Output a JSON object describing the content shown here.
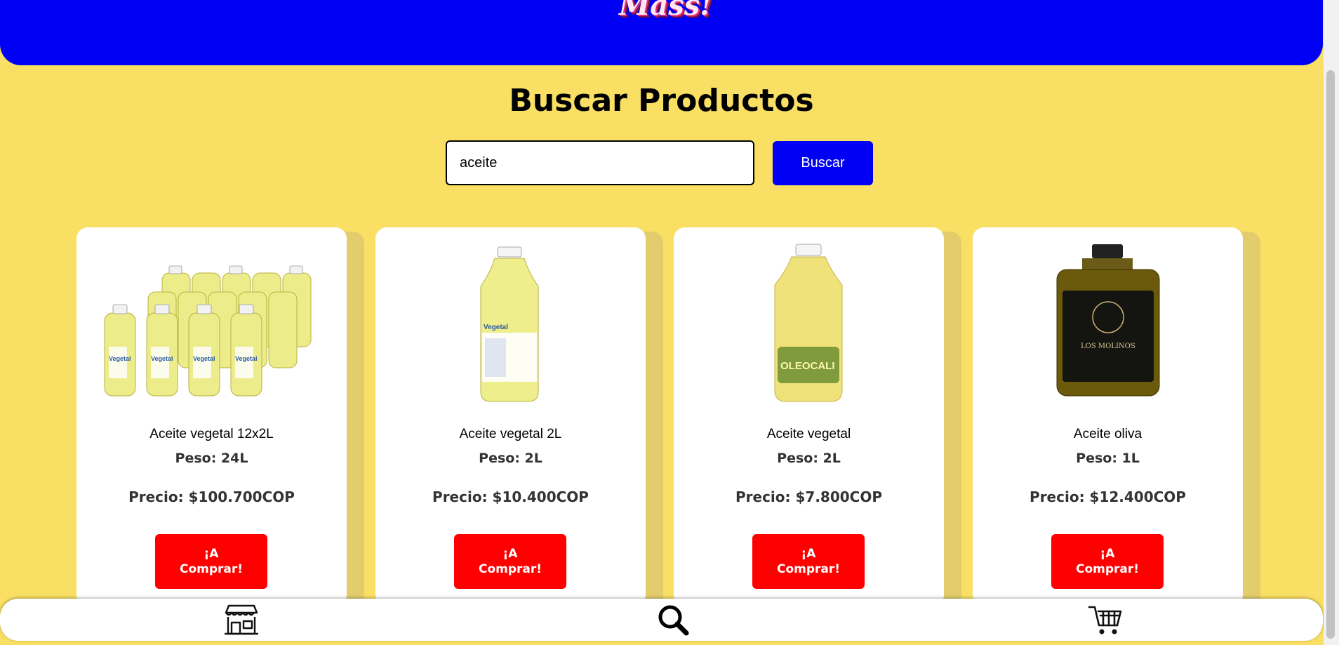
{
  "header": {
    "logo_text": "Mass!"
  },
  "search": {
    "title": "Buscar Productos",
    "value": "aceite",
    "button_label": "Buscar"
  },
  "products": [
    {
      "name": "Aceite vegetal 12x2L",
      "weight": "Peso: 24L",
      "price": "Precio: $100.700COP",
      "button_label": "¡A\nComprar!",
      "label_text": "Vegetal"
    },
    {
      "name": "Aceite vegetal 2L",
      "weight": "Peso: 2L",
      "price": "Precio: $10.400COP",
      "button_label": "¡A\nComprar!",
      "label_text": "Vegetal"
    },
    {
      "name": "Aceite vegetal",
      "weight": "Peso: 2L",
      "price": "Precio: $7.800COP",
      "button_label": "¡A\nComprar!",
      "label_text": "OLEOCALI"
    },
    {
      "name": "Aceite oliva",
      "weight": "Peso: 1L",
      "price": "Precio: $12.400COP",
      "button_label": "¡A\nComprar!",
      "label_text": "LOS MOLINOS"
    }
  ],
  "bottom_nav": {
    "items": [
      {
        "icon": "store-icon"
      },
      {
        "icon": "search-icon"
      },
      {
        "icon": "cart-icon"
      }
    ]
  },
  "colors": {
    "background": "#f9df63",
    "header": "#0000f5",
    "primary_button": "#0000f5",
    "buy_button": "#ff0000"
  }
}
